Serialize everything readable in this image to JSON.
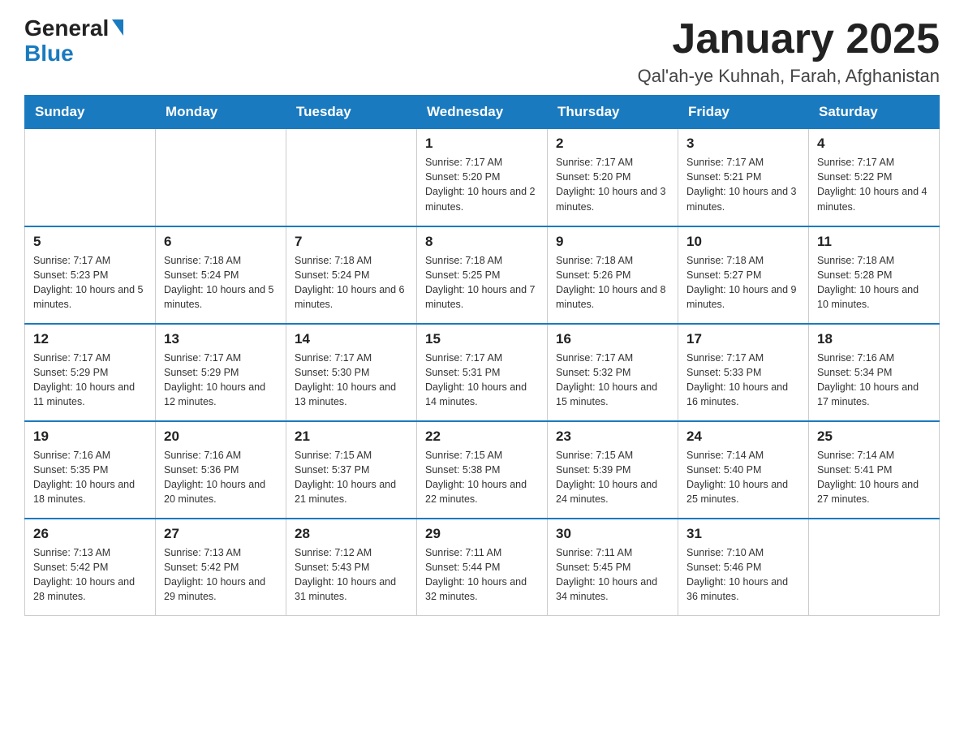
{
  "logo": {
    "text_general": "General",
    "text_blue": "Blue"
  },
  "header": {
    "month_year": "January 2025",
    "location": "Qal'ah-ye Kuhnah, Farah, Afghanistan"
  },
  "weekdays": [
    "Sunday",
    "Monday",
    "Tuesday",
    "Wednesday",
    "Thursday",
    "Friday",
    "Saturday"
  ],
  "weeks": [
    [
      {
        "day": "",
        "info": ""
      },
      {
        "day": "",
        "info": ""
      },
      {
        "day": "",
        "info": ""
      },
      {
        "day": "1",
        "info": "Sunrise: 7:17 AM\nSunset: 5:20 PM\nDaylight: 10 hours and 2 minutes."
      },
      {
        "day": "2",
        "info": "Sunrise: 7:17 AM\nSunset: 5:20 PM\nDaylight: 10 hours and 3 minutes."
      },
      {
        "day": "3",
        "info": "Sunrise: 7:17 AM\nSunset: 5:21 PM\nDaylight: 10 hours and 3 minutes."
      },
      {
        "day": "4",
        "info": "Sunrise: 7:17 AM\nSunset: 5:22 PM\nDaylight: 10 hours and 4 minutes."
      }
    ],
    [
      {
        "day": "5",
        "info": "Sunrise: 7:17 AM\nSunset: 5:23 PM\nDaylight: 10 hours and 5 minutes."
      },
      {
        "day": "6",
        "info": "Sunrise: 7:18 AM\nSunset: 5:24 PM\nDaylight: 10 hours and 5 minutes."
      },
      {
        "day": "7",
        "info": "Sunrise: 7:18 AM\nSunset: 5:24 PM\nDaylight: 10 hours and 6 minutes."
      },
      {
        "day": "8",
        "info": "Sunrise: 7:18 AM\nSunset: 5:25 PM\nDaylight: 10 hours and 7 minutes."
      },
      {
        "day": "9",
        "info": "Sunrise: 7:18 AM\nSunset: 5:26 PM\nDaylight: 10 hours and 8 minutes."
      },
      {
        "day": "10",
        "info": "Sunrise: 7:18 AM\nSunset: 5:27 PM\nDaylight: 10 hours and 9 minutes."
      },
      {
        "day": "11",
        "info": "Sunrise: 7:18 AM\nSunset: 5:28 PM\nDaylight: 10 hours and 10 minutes."
      }
    ],
    [
      {
        "day": "12",
        "info": "Sunrise: 7:17 AM\nSunset: 5:29 PM\nDaylight: 10 hours and 11 minutes."
      },
      {
        "day": "13",
        "info": "Sunrise: 7:17 AM\nSunset: 5:29 PM\nDaylight: 10 hours and 12 minutes."
      },
      {
        "day": "14",
        "info": "Sunrise: 7:17 AM\nSunset: 5:30 PM\nDaylight: 10 hours and 13 minutes."
      },
      {
        "day": "15",
        "info": "Sunrise: 7:17 AM\nSunset: 5:31 PM\nDaylight: 10 hours and 14 minutes."
      },
      {
        "day": "16",
        "info": "Sunrise: 7:17 AM\nSunset: 5:32 PM\nDaylight: 10 hours and 15 minutes."
      },
      {
        "day": "17",
        "info": "Sunrise: 7:17 AM\nSunset: 5:33 PM\nDaylight: 10 hours and 16 minutes."
      },
      {
        "day": "18",
        "info": "Sunrise: 7:16 AM\nSunset: 5:34 PM\nDaylight: 10 hours and 17 minutes."
      }
    ],
    [
      {
        "day": "19",
        "info": "Sunrise: 7:16 AM\nSunset: 5:35 PM\nDaylight: 10 hours and 18 minutes."
      },
      {
        "day": "20",
        "info": "Sunrise: 7:16 AM\nSunset: 5:36 PM\nDaylight: 10 hours and 20 minutes."
      },
      {
        "day": "21",
        "info": "Sunrise: 7:15 AM\nSunset: 5:37 PM\nDaylight: 10 hours and 21 minutes."
      },
      {
        "day": "22",
        "info": "Sunrise: 7:15 AM\nSunset: 5:38 PM\nDaylight: 10 hours and 22 minutes."
      },
      {
        "day": "23",
        "info": "Sunrise: 7:15 AM\nSunset: 5:39 PM\nDaylight: 10 hours and 24 minutes."
      },
      {
        "day": "24",
        "info": "Sunrise: 7:14 AM\nSunset: 5:40 PM\nDaylight: 10 hours and 25 minutes."
      },
      {
        "day": "25",
        "info": "Sunrise: 7:14 AM\nSunset: 5:41 PM\nDaylight: 10 hours and 27 minutes."
      }
    ],
    [
      {
        "day": "26",
        "info": "Sunrise: 7:13 AM\nSunset: 5:42 PM\nDaylight: 10 hours and 28 minutes."
      },
      {
        "day": "27",
        "info": "Sunrise: 7:13 AM\nSunset: 5:42 PM\nDaylight: 10 hours and 29 minutes."
      },
      {
        "day": "28",
        "info": "Sunrise: 7:12 AM\nSunset: 5:43 PM\nDaylight: 10 hours and 31 minutes."
      },
      {
        "day": "29",
        "info": "Sunrise: 7:11 AM\nSunset: 5:44 PM\nDaylight: 10 hours and 32 minutes."
      },
      {
        "day": "30",
        "info": "Sunrise: 7:11 AM\nSunset: 5:45 PM\nDaylight: 10 hours and 34 minutes."
      },
      {
        "day": "31",
        "info": "Sunrise: 7:10 AM\nSunset: 5:46 PM\nDaylight: 10 hours and 36 minutes."
      },
      {
        "day": "",
        "info": ""
      }
    ]
  ]
}
